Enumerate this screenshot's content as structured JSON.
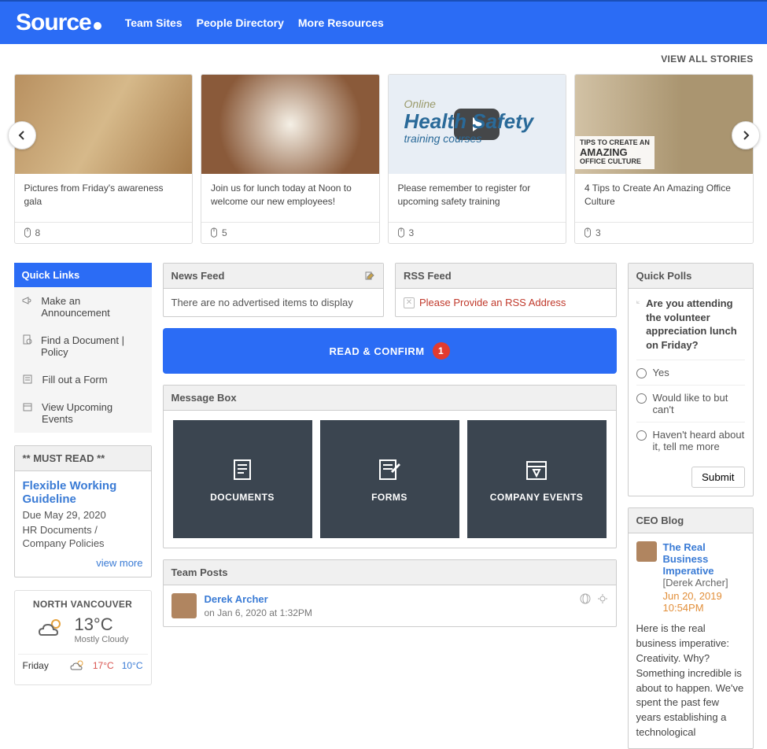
{
  "brand": "Source",
  "nav": {
    "team_sites": "Team Sites",
    "people_dir": "People Directory",
    "more": "More Resources"
  },
  "view_all": "VIEW ALL STORIES",
  "stories": [
    {
      "title": "Pictures from Friday's awareness gala",
      "count": "8"
    },
    {
      "title": "Join us for lunch today at Noon to welcome our new employees!",
      "count": "5"
    },
    {
      "title": "Please remember to register for upcoming safety training",
      "count": "3",
      "overlay_online": "Online",
      "overlay_hs": "Health Safety",
      "overlay_tc": "training courses"
    },
    {
      "title": "4 Tips to Create An Amazing Office Culture",
      "count": "3",
      "tip_line1": "TIPS TO CREATE AN",
      "tip_line2": "AMAZING",
      "tip_line3": "OFFICE CULTURE"
    }
  ],
  "quick_links": {
    "header": "Quick Links",
    "items": [
      "Make an Announcement",
      "Find a Document | Policy",
      "Fill out a Form",
      "View Upcoming Events"
    ]
  },
  "must_read": {
    "header": "** MUST READ **",
    "title": "Flexible Working Guideline",
    "due": "Due May 29, 2020",
    "cat": "HR Documents / Company Policies",
    "link": "view more"
  },
  "weather": {
    "city": "NORTH VANCOUVER",
    "temp": "13°C",
    "cond": "Mostly Cloudy",
    "fc_day": "Friday",
    "hi": "17°C",
    "lo": "10°C"
  },
  "newsfeed": {
    "header": "News Feed",
    "empty": "There are no advertised items to display"
  },
  "rss": {
    "header": "RSS Feed",
    "msg": "Please Provide an RSS Address"
  },
  "read_confirm": {
    "label": "READ & CONFIRM",
    "count": "1"
  },
  "msgbox": {
    "header": "Message Box",
    "items": [
      "DOCUMENTS",
      "FORMS",
      "COMPANY EVENTS"
    ]
  },
  "teamposts": {
    "header": "Team Posts",
    "post": {
      "author": "Derek Archer",
      "meta": "on Jan 6, 2020 at 1:32PM"
    }
  },
  "poll": {
    "header": "Quick Polls",
    "question": "Are you attending the volunteer appreciation lunch on Friday?",
    "opts": [
      "Yes",
      "Would like to but can't",
      "Haven't heard about it, tell me more"
    ],
    "submit": "Submit"
  },
  "ceo": {
    "header": "CEO Blog",
    "title": "The Real Business Imperative",
    "author": "[Derek Archer]",
    "date": "Jun 20, 2019 10:54PM",
    "text": "Here is the real business imperative: Creativity. Why? Something incredible is about to happen. We've spent the past few years establishing a technological"
  }
}
